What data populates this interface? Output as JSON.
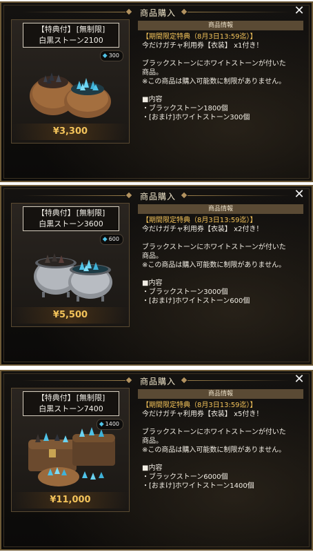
{
  "panels": [
    {
      "header_title": "商品購入",
      "close_icon": "close-icon",
      "item": {
        "tag_bonus": "【特典付】",
        "tag_limit": "[無制限]",
        "name": "白黒ストーン2100",
        "stone_count": "300",
        "price": "¥3,300",
        "art_icon": "stone-bags-2"
      },
      "info": {
        "title": "商品情報",
        "line1": "【期間限定特典（8月3日13:59迄）】",
        "line2": "今だけガチャ利用券【衣装】 x1付き！",
        "line3": "ブラックストーンにホワイトストーンが付いた",
        "line4": "商品。",
        "line5": "※この商品は購入可能数に制限がありません。",
        "contents_title": "■内容",
        "content1": "・ブラックストーン1800個",
        "content2": "・[おまけ]ホワイトストーン300個"
      }
    },
    {
      "header_title": "商品購入",
      "close_icon": "close-icon",
      "item": {
        "tag_bonus": "【特典付】",
        "tag_limit": "[無制限]",
        "name": "白黒ストーン3600",
        "stone_count": "600",
        "price": "¥5,500",
        "art_icon": "stone-cauldrons-2"
      },
      "info": {
        "title": "商品情報",
        "line1": "【期間限定特典（8月3日13:59迄）】",
        "line2": "今だけガチャ利用券【衣装】 x2付き！",
        "line3": "ブラックストーンにホワイトストーンが付いた",
        "line4": "商品。",
        "line5": "※この商品は購入可能数に制限がありません。",
        "contents_title": "■内容",
        "content1": "・ブラックストーン3000個",
        "content2": "・[おまけ]ホワイトストーン600個"
      }
    },
    {
      "header_title": "商品購入",
      "close_icon": "close-icon",
      "item": {
        "tag_bonus": "【特典付】",
        "tag_limit": "[無制限]",
        "name": "白黒ストーン7400",
        "stone_count": "1400",
        "price": "¥11,000",
        "art_icon": "stone-chests"
      },
      "info": {
        "title": "商品情報",
        "line1": "【期間限定特典（8月3日13:59迄）】",
        "line2": "今だけガチャ利用券【衣装】 x5付き！",
        "line3": "ブラックストーンにホワイトストーンが付いた",
        "line4": "商品。",
        "line5": "※この商品は購入可能数に制限がありません。",
        "contents_title": "■内容",
        "content1": "・ブラックストーン6000個",
        "content2": "・[おまけ]ホワイトストーン1400個"
      }
    }
  ],
  "colors": {
    "accent_gold": "#f3c35a",
    "stone_cyan": "#4fc3e8",
    "frame": "#6e5a37"
  }
}
